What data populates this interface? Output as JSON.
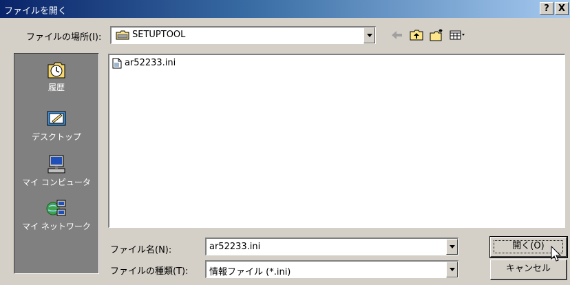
{
  "window": {
    "title": "ファイルを開く",
    "help_label": "?",
    "close_label": "X"
  },
  "lookin": {
    "label": "ファイルの場所(I):",
    "value": "SETUPTOOL"
  },
  "toolbar": {
    "icons": [
      "back-arrow-icon",
      "up-folder-icon",
      "new-folder-icon",
      "view-menu-icon"
    ]
  },
  "places": {
    "items": [
      {
        "label": "履歴",
        "icon": "history-icon"
      },
      {
        "label": "デスクトップ",
        "icon": "desktop-icon"
      },
      {
        "label": "マイ コンピュータ",
        "icon": "my-computer-icon"
      },
      {
        "label": "マイ ネットワーク",
        "icon": "network-icon"
      }
    ]
  },
  "files": [
    {
      "name": "ar52233.ini",
      "icon": "ini-file-icon"
    }
  ],
  "filename": {
    "label": "ファイル名(N):",
    "value": "ar52233.ini"
  },
  "filetype": {
    "label": "ファイルの種類(T):",
    "value": "情報ファイル (*.ini)"
  },
  "buttons": {
    "open_label": "開く(O)",
    "cancel_label": "キャンセル"
  },
  "colors": {
    "title_start": "#0a246a",
    "title_end": "#a6caf0",
    "face": "#d4d0c8",
    "places_bg": "#808080"
  }
}
